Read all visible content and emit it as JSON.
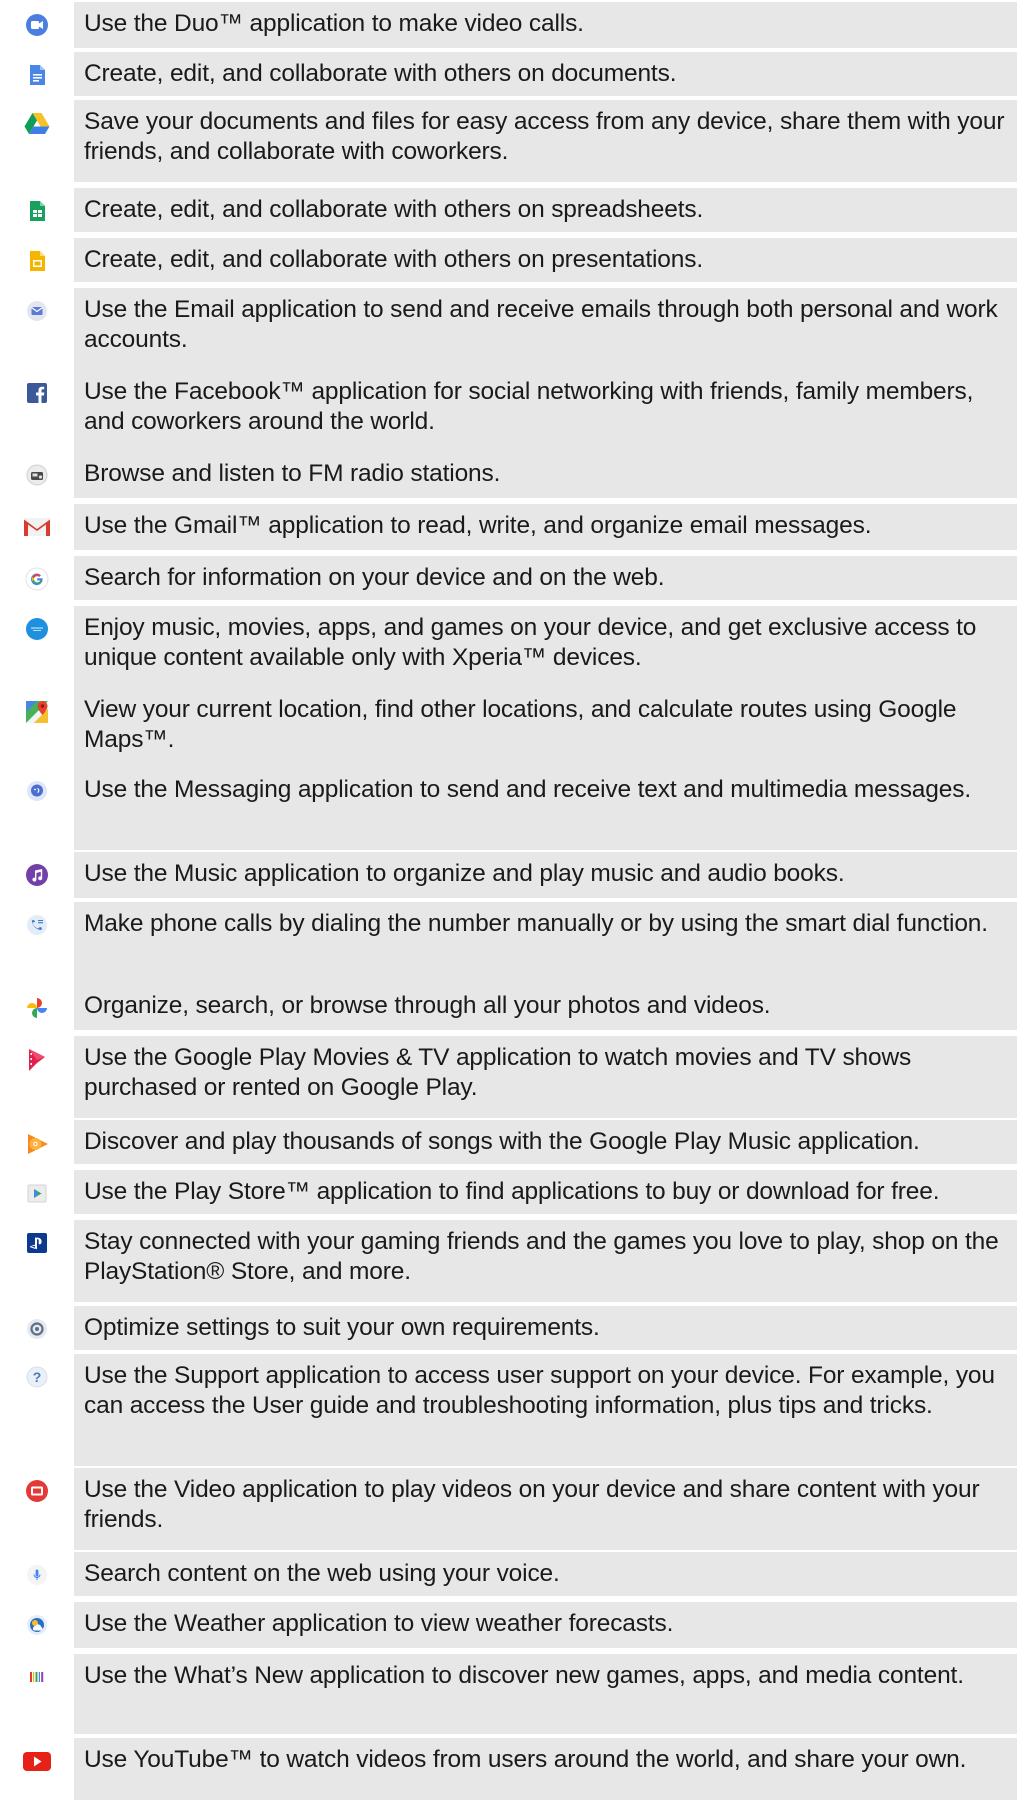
{
  "apps": [
    {
      "icon": "duo-icon",
      "description": "Use the Duo™ application to make video calls."
    },
    {
      "icon": "docs-icon",
      "description": "Create, edit, and collaborate with others on documents."
    },
    {
      "icon": "drive-icon",
      "description": "Save your documents and files for easy access from any device, share them with your friends, and collaborate with coworkers."
    },
    {
      "icon": "sheets-icon",
      "description": "Create, edit, and collaborate with others on spreadsheets."
    },
    {
      "icon": "slides-icon",
      "description": "Create, edit, and collaborate with others on presentations."
    },
    {
      "icon": "email-icon",
      "description": "Use the Email application to send and receive emails through both personal and work accounts."
    },
    {
      "icon": "facebook-icon",
      "description": "Use the Facebook™ application for social networking with friends, family members, and coworkers around the world."
    },
    {
      "icon": "fm-radio-icon",
      "description": "Browse and listen to FM radio stations."
    },
    {
      "icon": "gmail-icon",
      "description": "Use the Gmail™ application to read, write, and organize email messages."
    },
    {
      "icon": "google-icon",
      "description": "Search for information on your device and on the web."
    },
    {
      "icon": "xperia-lounge-icon",
      "description": "Enjoy music, movies, apps, and games on your device, and get exclusive access to unique content available only with Xperia™ devices."
    },
    {
      "icon": "maps-icon",
      "description": "View your current location, find other locations, and calculate routes using Google Maps™."
    },
    {
      "icon": "messaging-icon",
      "description": "Use the Messaging application to send and receive text and multimedia messages."
    },
    {
      "icon": "music-icon",
      "description": "Use the Music application to organize and play music and audio books."
    },
    {
      "icon": "phone-icon",
      "description": "Make phone calls by dialing the number manually or by using the smart dial function."
    },
    {
      "icon": "photos-icon",
      "description": "Organize, search, or browse through all your photos and videos."
    },
    {
      "icon": "play-movies-icon",
      "description": "Use the Google Play Movies & TV application to watch movies and TV shows purchased or rented on Google Play."
    },
    {
      "icon": "play-music-icon",
      "description": "Discover and play thousands of songs with the Google Play Music application."
    },
    {
      "icon": "play-store-icon",
      "description": "Use the Play Store™ application to find applications to buy or download for free."
    },
    {
      "icon": "playstation-icon",
      "description": "Stay connected with your gaming friends and the games you love to play, shop on the PlayStation® Store, and more."
    },
    {
      "icon": "settings-icon",
      "description": "Optimize settings to suit your own requirements."
    },
    {
      "icon": "support-icon",
      "description": "Use the Support application to access user support on your device. For example, you can access the User guide and troubleshooting information, plus tips and tricks."
    },
    {
      "icon": "video-icon",
      "description": "Use the Video application to play videos on your device and share content with your friends."
    },
    {
      "icon": "voice-search-icon",
      "description": "Search content on the web using your voice."
    },
    {
      "icon": "weather-icon",
      "description": "Use the Weather application to view weather forecasts."
    },
    {
      "icon": "whats-new-icon",
      "description": "Use the What’s New application to discover new games, apps, and media content."
    },
    {
      "icon": "youtube-icon",
      "description": "Use YouTube™ to watch videos from users around the world, and share your own."
    }
  ]
}
